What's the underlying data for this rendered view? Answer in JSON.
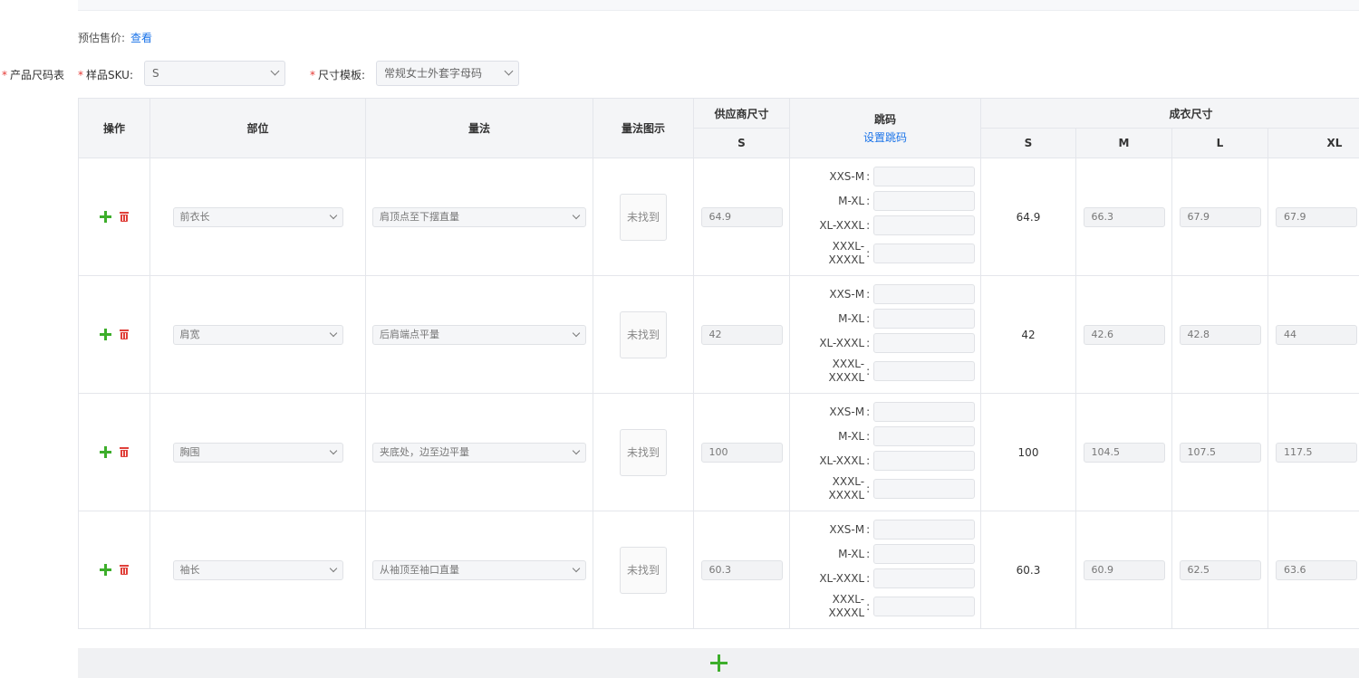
{
  "price": {
    "label": "预估售价:",
    "link": "查看"
  },
  "form": {
    "size_table_label": "产品尺码表",
    "sku_label": "样品SKU:",
    "sku_value": "S",
    "template_label": "尺寸模板:",
    "template_value": "常规女士外套字母码"
  },
  "table": {
    "headers": {
      "ops": "操作",
      "part": "部位",
      "method": "量法",
      "diagram": "量法图示",
      "supplier": "供应商尺寸",
      "supplier_size": "S",
      "jump": "跳码",
      "jump_link": "设置跳码",
      "finished": "成衣尺寸",
      "finished_sizes": [
        "S",
        "M",
        "L",
        "XL"
      ]
    },
    "jump_labels": [
      "XXS-M",
      "M-XL",
      "XL-XXXL",
      "XXXL-XXXXL"
    ],
    "not_found": "未找到",
    "rows": [
      {
        "part": "前衣长",
        "method": "肩顶点至下摆直量",
        "supplier": "64.9",
        "fin_s": "64.9",
        "fin_m": "66.3",
        "fin_l": "67.9",
        "fin_xl": "67.9"
      },
      {
        "part": "肩宽",
        "method": "后肩端点平量",
        "supplier": "42",
        "fin_s": "42",
        "fin_m": "42.6",
        "fin_l": "42.8",
        "fin_xl": "44"
      },
      {
        "part": "胸围",
        "method": "夹底处，边至边平量",
        "supplier": "100",
        "fin_s": "100",
        "fin_m": "104.5",
        "fin_l": "107.5",
        "fin_xl": "117.5"
      },
      {
        "part": "袖长",
        "method": "从袖顶至袖口直量",
        "supplier": "60.3",
        "fin_s": "60.3",
        "fin_m": "60.9",
        "fin_l": "62.5",
        "fin_xl": "63.6"
      }
    ]
  },
  "colors": {
    "accent": "#1a73e8",
    "add": "#3dae2b",
    "delete": "#e0403a",
    "required": "#e53935"
  }
}
